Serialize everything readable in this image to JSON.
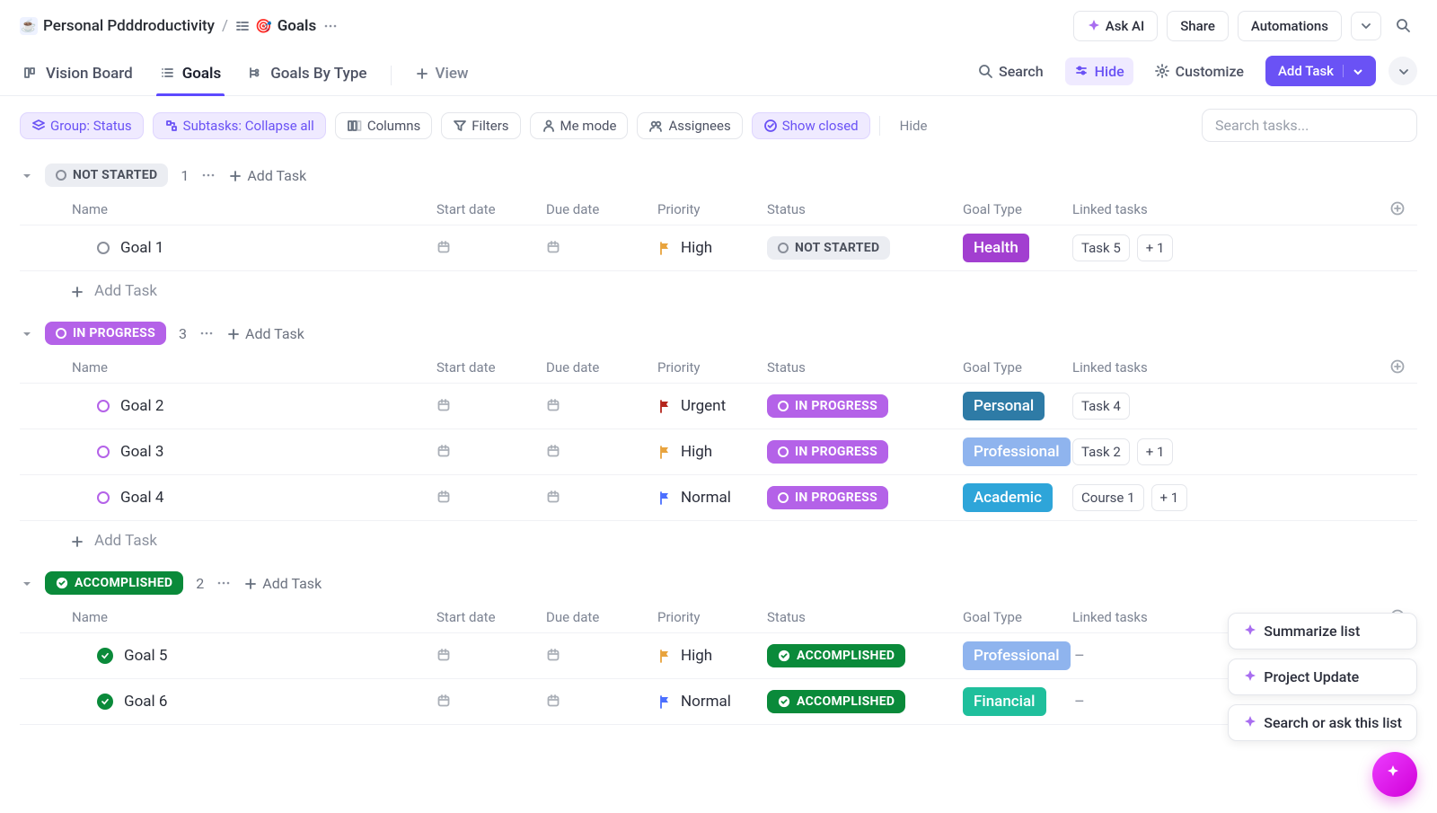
{
  "breadcrumb": {
    "workspace_emoji": "☕",
    "workspace": "Personal Pdddroductivity",
    "sep": "/",
    "page_icon": "🎯",
    "page": "Goals"
  },
  "top_actions": {
    "ask_ai": "Ask AI",
    "share": "Share",
    "automations": "Automations"
  },
  "views": {
    "vision_board": "Vision Board",
    "goals": "Goals",
    "goals_by_type": "Goals By Type",
    "add_view": "View"
  },
  "view_actions": {
    "search": "Search",
    "hide": "Hide",
    "customize": "Customize",
    "add_task": "Add Task"
  },
  "filters": {
    "group": "Group: Status",
    "subtasks": "Subtasks: Collapse all",
    "columns": "Columns",
    "filters": "Filters",
    "me_mode": "Me mode",
    "assignees": "Assignees",
    "show_closed": "Show closed",
    "hide": "Hide",
    "search_placeholder": "Search tasks..."
  },
  "columns": {
    "name": "Name",
    "start_date": "Start date",
    "due_date": "Due date",
    "priority": "Priority",
    "status": "Status",
    "goal_type": "Goal Type",
    "linked_tasks": "Linked tasks",
    "add_task": "Add Task"
  },
  "status_colors": {
    "not_started": {
      "bg": "#ebedf2",
      "fg": "#4c515d",
      "dot": "#8a8f9a"
    },
    "in_progress": {
      "bg": "#b462e8",
      "fg": "#ffffff",
      "dot": "#ffffff"
    },
    "accomplished": {
      "bg": "#0a8a3a",
      "fg": "#ffffff"
    }
  },
  "priority_colors": {
    "Urgent": "#b5261d",
    "High": "#e8a33d",
    "Normal": "#4b6fff"
  },
  "goal_type_colors": {
    "Health": "#a23fd0",
    "Personal": "#2e7ba6",
    "Professional": "#8fb4ee",
    "Academic": "#2ea5d9",
    "Financial": "#1fbf9c"
  },
  "groups": [
    {
      "key": "not_started",
      "label": "NOT STARTED",
      "count": "1",
      "tasks": [
        {
          "name": "Goal 1",
          "priority": "High",
          "status_pill": "NOT STARTED",
          "goal_type": "Health",
          "linked": [
            "Task 5"
          ],
          "overflow": "+ 1",
          "row_icon": "ring",
          "ring_color": "#8a8f9a",
          "pill_bg": "#ebedf2",
          "pill_fg": "#4c515d",
          "pill_dot": "#8a8f9a"
        }
      ],
      "show_add_row": true
    },
    {
      "key": "in_progress",
      "label": "IN PROGRESS",
      "count": "3",
      "tasks": [
        {
          "name": "Goal 2",
          "priority": "Urgent",
          "status_pill": "IN PROGRESS",
          "goal_type": "Personal",
          "linked": [
            "Task 4"
          ],
          "overflow": "",
          "row_icon": "ring",
          "ring_color": "#b462e8",
          "pill_bg": "#b462e8",
          "pill_fg": "#ffffff",
          "pill_dot": "#ffffff"
        },
        {
          "name": "Goal 3",
          "priority": "High",
          "status_pill": "IN PROGRESS",
          "goal_type": "Professional",
          "linked": [
            "Task 2"
          ],
          "overflow": "+ 1",
          "row_icon": "ring",
          "ring_color": "#b462e8",
          "pill_bg": "#b462e8",
          "pill_fg": "#ffffff",
          "pill_dot": "#ffffff"
        },
        {
          "name": "Goal 4",
          "priority": "Normal",
          "status_pill": "IN PROGRESS",
          "goal_type": "Academic",
          "linked": [
            "Course 1"
          ],
          "overflow": "+ 1",
          "row_icon": "ring",
          "ring_color": "#b462e8",
          "pill_bg": "#b462e8",
          "pill_fg": "#ffffff",
          "pill_dot": "#ffffff"
        }
      ],
      "show_add_row": true
    },
    {
      "key": "accomplished",
      "label": "ACCOMPLISHED",
      "count": "2",
      "tasks": [
        {
          "name": "Goal 5",
          "priority": "High",
          "status_pill": "ACCOMPLISHED",
          "goal_type": "Professional",
          "linked": [],
          "overflow": "",
          "row_icon": "check",
          "ring_color": "#0a8a3a",
          "pill_bg": "#0a8a3a",
          "pill_fg": "#ffffff",
          "pill_check": true
        },
        {
          "name": "Goal 6",
          "priority": "Normal",
          "status_pill": "ACCOMPLISHED",
          "goal_type": "Financial",
          "linked": [],
          "overflow": "",
          "row_icon": "check",
          "ring_color": "#0a8a3a",
          "pill_bg": "#0a8a3a",
          "pill_fg": "#ffffff",
          "pill_check": true
        }
      ],
      "show_add_row": false
    }
  ],
  "floating": {
    "summarize": "Summarize list",
    "project_update": "Project Update",
    "search_ask": "Search or ask this list"
  }
}
